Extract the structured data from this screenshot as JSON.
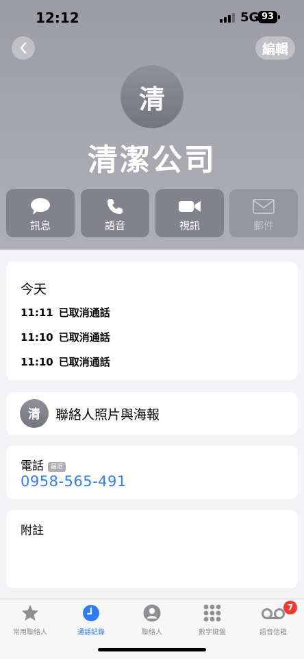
{
  "status_bar": {
    "time": "12:12",
    "network": "5G",
    "battery": "93"
  },
  "nav": {
    "edit_label": "編輯"
  },
  "contact": {
    "avatar_initial": "清",
    "name": "清潔公司"
  },
  "actions": [
    {
      "label": "訊息",
      "icon": "message-icon",
      "enabled": true
    },
    {
      "label": "語音",
      "icon": "phone-icon",
      "enabled": true
    },
    {
      "label": "視訊",
      "icon": "video-icon",
      "enabled": true
    },
    {
      "label": "郵件",
      "icon": "mail-icon",
      "enabled": false
    }
  ],
  "recents": {
    "title": "今天",
    "calls": [
      {
        "time": "11:11",
        "status": "已取消通話"
      },
      {
        "time": "11:10",
        "status": "已取消通話"
      },
      {
        "time": "11:10",
        "status": "已取消通話"
      }
    ]
  },
  "poster": {
    "avatar_initial": "清",
    "label": "聯絡人照片與海報"
  },
  "phone": {
    "label": "電話",
    "badge": "最近",
    "number": "0958-565-491"
  },
  "notes": {
    "label": "附註"
  },
  "tabbar": {
    "tabs": [
      {
        "label": "常用聯絡人",
        "icon": "star-icon"
      },
      {
        "label": "通話記錄",
        "icon": "clock-icon",
        "active": true
      },
      {
        "label": "聯絡人",
        "icon": "person-icon"
      },
      {
        "label": "數字鍵盤",
        "icon": "keypad-icon"
      },
      {
        "label": "語音信箱",
        "icon": "voicemail-icon"
      }
    ],
    "voicemail_badge": "7"
  },
  "colors": {
    "accent": "#2f7cf6",
    "badge": "#f23b30"
  }
}
